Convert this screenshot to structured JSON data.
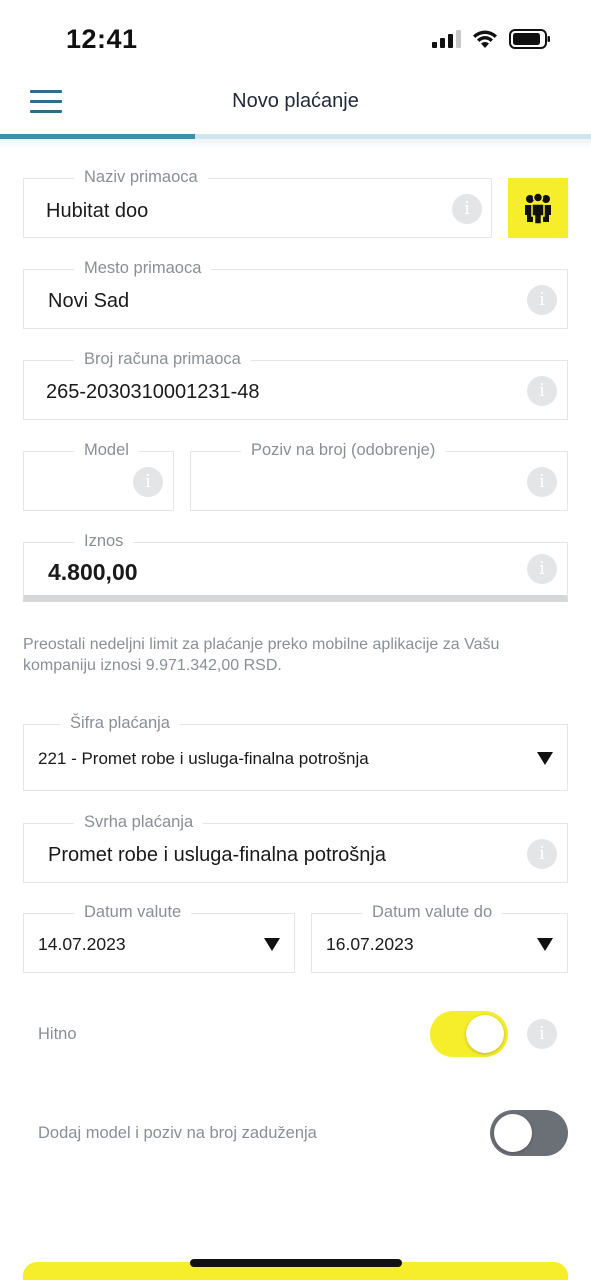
{
  "status_bar": {
    "time": "12:41"
  },
  "header": {
    "title": "Novo plaćanje",
    "menu_icon": "hamburger-icon",
    "progress_fraction": 0.33
  },
  "recipient_name": {
    "label": "Naziv primaoca",
    "value": "Hubitat doo",
    "contacts_icon": "people-icon"
  },
  "recipient_city": {
    "label": "Mesto primaoca",
    "value": "Novi Sad"
  },
  "recipient_account": {
    "label": "Broj računa primaoca",
    "value": "265-2030310001231-48"
  },
  "model": {
    "label": "Model",
    "value": ""
  },
  "reference": {
    "label": "Poziv na broj (odobrenje)",
    "value": ""
  },
  "amount": {
    "label": "Iznos",
    "value": "4.800,00"
  },
  "limit_note": "Preostali nedeljni limit za plaćanje preko mobilne aplikacije za Vašu kompaniju iznosi 9.971.342,00 RSD.",
  "payment_code": {
    "label": "Šifra plaćanja",
    "value": "221 - Promet robe i usluga-finalna potrošnja"
  },
  "purpose": {
    "label": "Svrha plaćanja",
    "value": "Promet robe i usluga-finalna potrošnja"
  },
  "value_date": {
    "label": "Datum valute",
    "value": "14.07.2023"
  },
  "value_date_to": {
    "label": "Datum valute do",
    "value": "16.07.2023"
  },
  "urgent": {
    "label": "Hitno",
    "on": true
  },
  "debit_model": {
    "label": "Dodaj model i poziv na broj zaduženja",
    "on": false
  },
  "info_glyph": "i",
  "colors": {
    "accent_yellow": "#f6ee2a",
    "brand_blue": "#3d8fb0",
    "toggle_off": "#6b6f76"
  }
}
